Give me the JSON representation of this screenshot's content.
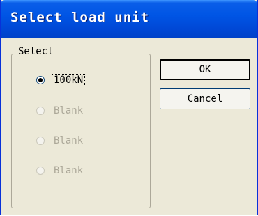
{
  "dialog": {
    "title": "Select load unit",
    "group_label": "Select",
    "options": [
      {
        "label": "100kN",
        "checked": true,
        "enabled": true
      },
      {
        "label": "Blank",
        "checked": false,
        "enabled": false
      },
      {
        "label": "Blank",
        "checked": false,
        "enabled": false
      },
      {
        "label": "Blank",
        "checked": false,
        "enabled": false
      }
    ],
    "ok_label": "OK",
    "cancel_label": "Cancel"
  },
  "colors": {
    "titlebar": "#0055e5",
    "dialog_background": "#ece9d8",
    "disabled_text": "#aca899"
  }
}
